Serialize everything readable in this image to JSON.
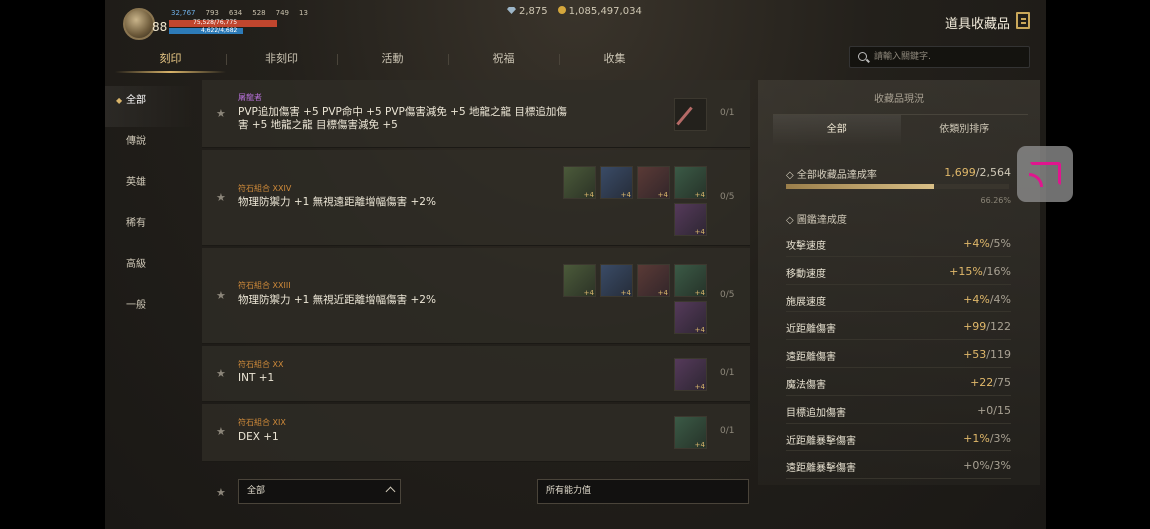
{
  "hud": {
    "level": "88",
    "stats": [
      "32,767",
      "793",
      "634",
      "528",
      "749",
      "13"
    ],
    "hp": "75,528/76,775",
    "mp": "4,622/4,682",
    "gems": "2,875",
    "gold": "1,085,497,034",
    "title": "道具收藏品"
  },
  "tabs": [
    "刻印",
    "非刻印",
    "活動",
    "祝福",
    "收集"
  ],
  "search": {
    "placeholder": "請輸入關鍵字."
  },
  "categories": [
    "全部",
    "傳說",
    "英雄",
    "稀有",
    "高級",
    "一般"
  ],
  "items": [
    {
      "name": "屠龍者",
      "effect": "PVP追加傷害 +5 PVP命中 +5 PVP傷害減免 +5 地龍之龍 目標追加傷害 +5 地龍之龍 目標傷害減免 +5",
      "count": "0/1"
    },
    {
      "name": "符石組合 XXIV",
      "effect": "物理防禦力 +1 無視遠距離增幅傷害 +2%",
      "count": "0/5"
    },
    {
      "name": "符石組合 XXIII",
      "effect": "物理防禦力 +1 無視近距離增幅傷害 +2%",
      "count": "0/5"
    },
    {
      "name": "符石組合 XX",
      "effect": "INT +1",
      "count": "0/1"
    },
    {
      "name": "符石組合 XIX",
      "effect": "DEX +1",
      "count": "0/1"
    }
  ],
  "filters": {
    "grade": "全部",
    "ability": "所有能力值"
  },
  "panel": {
    "title": "收藏品現況",
    "tabs": [
      "全部",
      "依類別排序"
    ],
    "total_label": "全部收藏品達成率",
    "total_value": "1,699",
    "total_max": "/2,564",
    "progress": 0.6626,
    "percent": "66.26%",
    "book_label": "圖鑑達成度",
    "stats": [
      {
        "name": "攻擊速度",
        "value": "+4%",
        "max": "/5%"
      },
      {
        "name": "移動速度",
        "value": "+15%",
        "max": "/16%"
      },
      {
        "name": "施展速度",
        "value": "+4%",
        "max": "/4%"
      },
      {
        "name": "近距離傷害",
        "value": "+99",
        "max": "/122"
      },
      {
        "name": "遠距離傷害",
        "value": "+53",
        "max": "/119"
      },
      {
        "name": "魔法傷害",
        "value": "+22",
        "max": "/75"
      },
      {
        "name": "目標追加傷害",
        "value": "+0",
        "max": "/15"
      },
      {
        "name": "近距離暴擊傷害",
        "value": "+1%",
        "max": "/3%"
      },
      {
        "name": "遠距離暴擊傷害",
        "value": "+0%",
        "max": "/3%"
      }
    ]
  },
  "icons": {
    "tab_marker": "◆",
    "star": "★",
    "diamond": "◇",
    "cast": "screen-cast-icon",
    "exit": "exit-icon",
    "search": "search-icon"
  },
  "colors": {
    "accent": "#d9b46a",
    "legendary": "#b46fd6",
    "rune": "#cf8a3a",
    "value": "#e0b86a",
    "hp": "#c0462e",
    "mp": "#2d7bb8"
  }
}
